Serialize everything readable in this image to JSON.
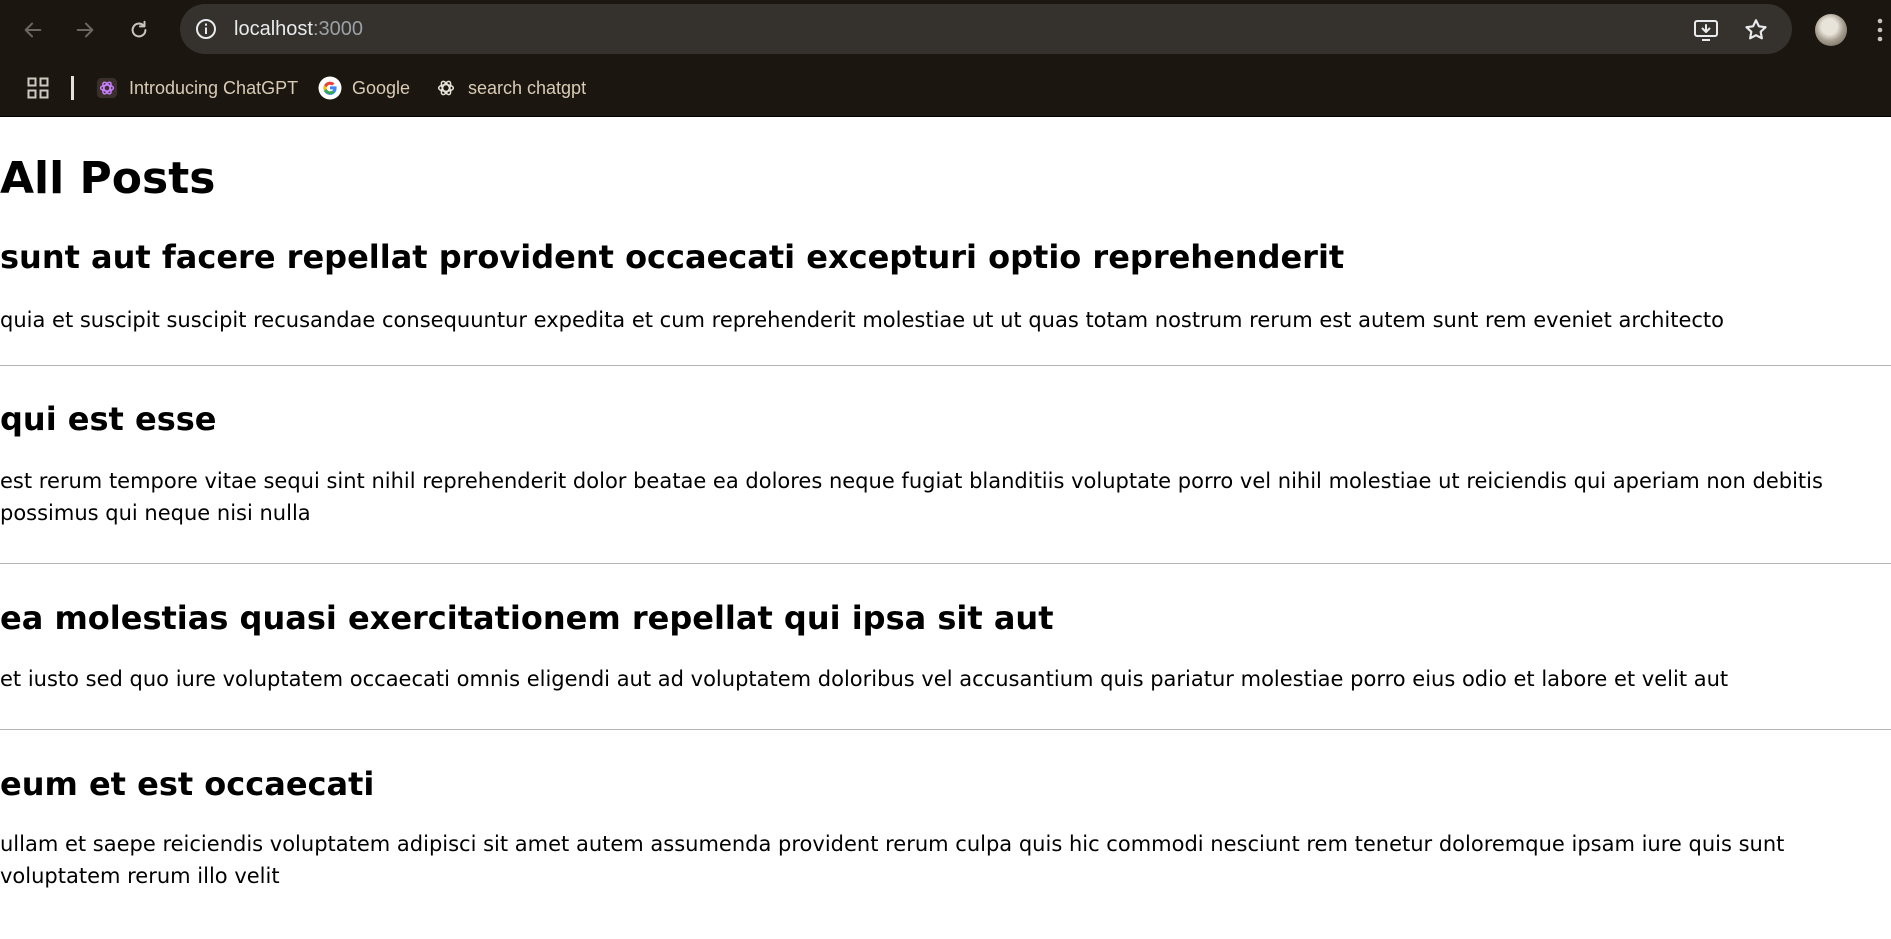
{
  "browser": {
    "url_host": "localhost",
    "url_port": ":3000",
    "bookmarks": [
      {
        "label": "Introducing ChatGPT",
        "icon": "openai-icon"
      },
      {
        "label": "Google",
        "icon": "google-icon"
      },
      {
        "label": "search chatgpt",
        "icon": "openai-icon"
      }
    ]
  },
  "page": {
    "title": "All Posts",
    "posts": [
      {
        "title": "sunt aut facere repellat provident occaecati excepturi optio reprehenderit",
        "body": "quia et suscipit suscipit recusandae consequuntur expedita et cum reprehenderit molestiae ut ut quas totam nostrum rerum est autem sunt rem eveniet architecto"
      },
      {
        "title": "qui est esse",
        "body": "est rerum tempore vitae sequi sint nihil reprehenderit dolor beatae ea dolores neque fugiat blanditiis voluptate porro vel nihil molestiae ut reiciendis qui aperiam non debitis possimus qui neque nisi nulla"
      },
      {
        "title": "ea molestias quasi exercitationem repellat qui ipsa sit aut",
        "body": "et iusto sed quo iure voluptatem occaecati omnis eligendi aut ad voluptatem doloribus vel accusantium quis pariatur molestiae porro eius odio et labore et velit aut"
      },
      {
        "title": "eum et est occaecati",
        "body": "ullam et saepe reiciendis voluptatem adipisci sit amet autem assumenda provident rerum culpa quis hic commodi nesciunt rem tenetur doloremque ipsam iure quis sunt voluptatem rerum illo velit"
      }
    ]
  }
}
